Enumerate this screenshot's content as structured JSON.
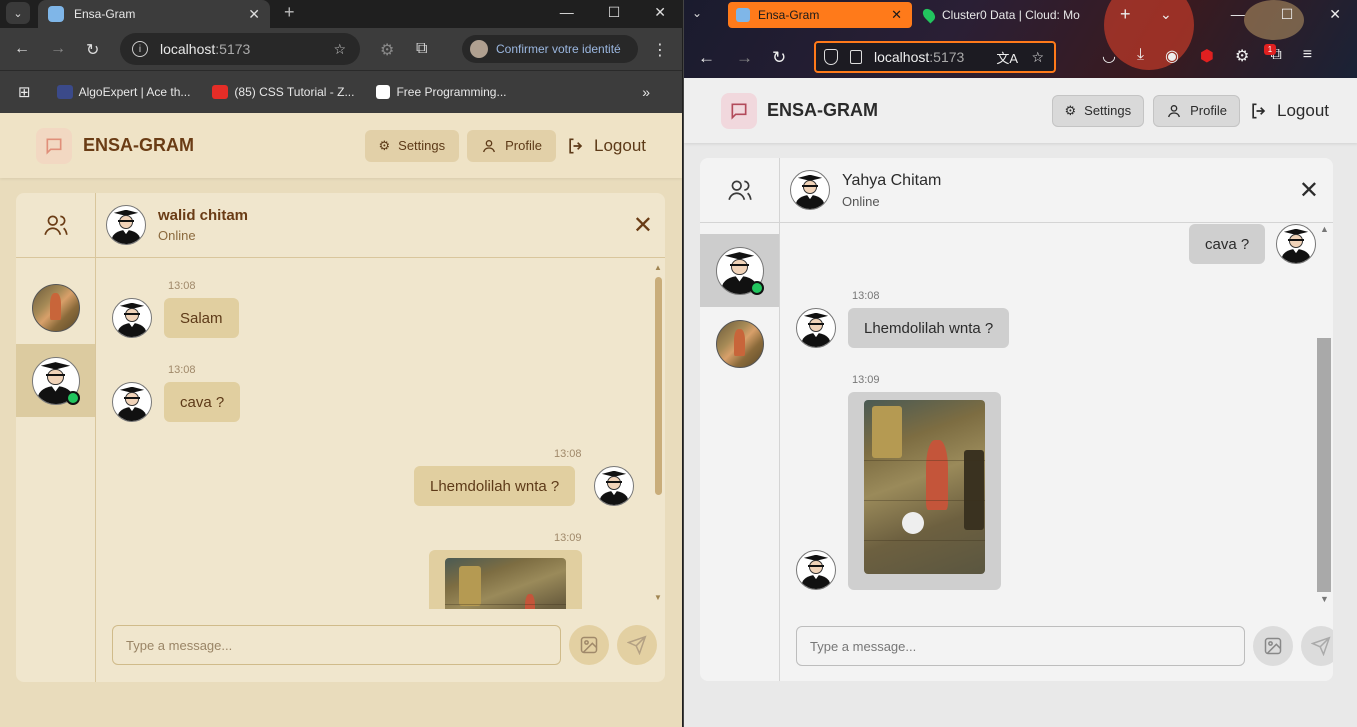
{
  "left_browser": {
    "tab_title": "Ensa-Gram",
    "url_host": "localhost",
    "url_port": ":5173",
    "identity_label": "Confirmer votre identité",
    "bookmarks": [
      {
        "label": "AlgoExpert | Ace th...",
        "color": "#3b4a8a"
      },
      {
        "label": "(85) CSS Tutorial - Z...",
        "color": "#e52d27"
      },
      {
        "label": "Free Programming...",
        "color": "#ffffff"
      }
    ]
  },
  "left_app": {
    "brand": "ENSA-GRAM",
    "settings_label": "Settings",
    "profile_label": "Profile",
    "logout_label": "Logout",
    "chat": {
      "name": "walid chitam",
      "status": "Online",
      "messages": [
        {
          "time": "13:08",
          "text": "Salam",
          "side": "in"
        },
        {
          "time": "13:08",
          "text": "cava ?",
          "side": "in"
        },
        {
          "time": "13:08",
          "text": "Lhemdolilah wnta ?",
          "side": "out"
        },
        {
          "time": "13:09",
          "text": "",
          "side": "out-image"
        }
      ]
    },
    "input_placeholder": "Type a message..."
  },
  "right_browser": {
    "tab_title": "Ensa-Gram",
    "tab2_title": "Cluster0 Data | Cloud: Mo",
    "url_host": "localhost",
    "url_port": ":5173",
    "notification_count": "1"
  },
  "right_app": {
    "brand": "ENSA-GRAM",
    "settings_label": "Settings",
    "profile_label": "Profile",
    "logout_label": "Logout",
    "chat": {
      "name": "Yahya Chitam",
      "status": "Online",
      "messages": [
        {
          "time": "",
          "text": "cava ?",
          "side": "out"
        },
        {
          "time": "13:08",
          "text": "Lhemdolilah wnta ?",
          "side": "in"
        },
        {
          "time": "13:09",
          "text": "",
          "side": "in-image"
        }
      ]
    },
    "input_placeholder": "Type a message..."
  },
  "colors": {
    "left_bg": "#e9dcbc",
    "left_bubble": "#e1cfa0",
    "left_text": "#6a3c15",
    "right_bg": "#e9e9e9",
    "right_bubble": "#cfcfcf",
    "ff_tab_accent": "#ff7a1a",
    "online": "#22c55e"
  }
}
